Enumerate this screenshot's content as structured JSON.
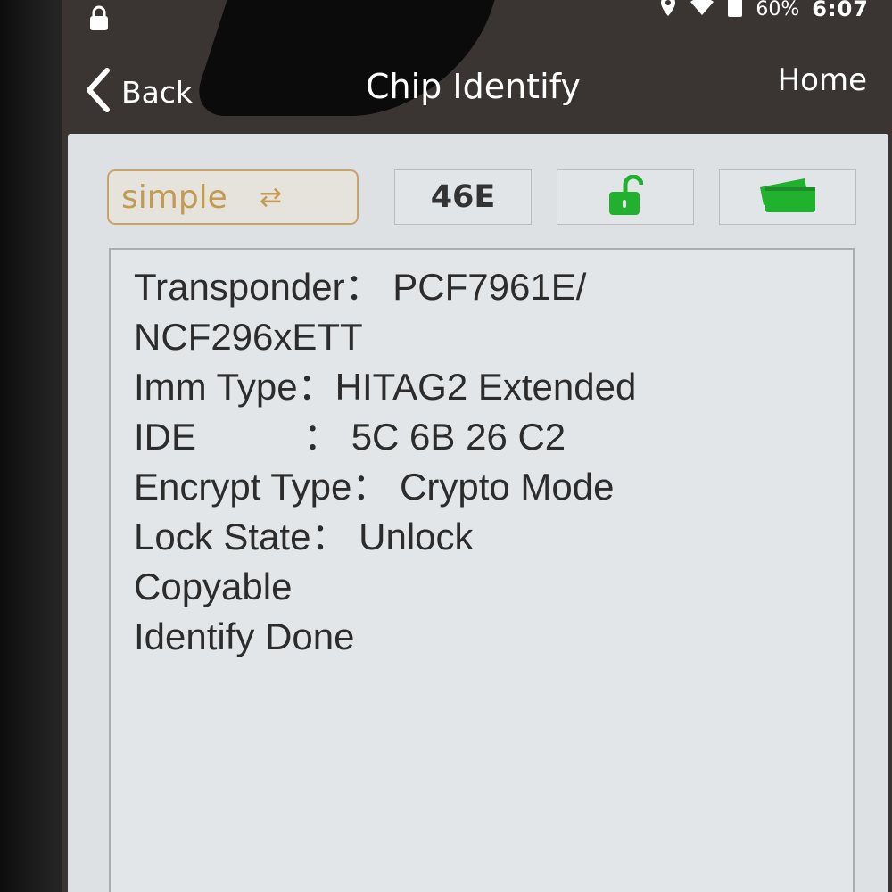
{
  "status_bar": {
    "battery": "60%",
    "time": "6:07",
    "icons": [
      "lock-icon",
      "location-icon",
      "wifi-icon",
      "battery-icon"
    ]
  },
  "header": {
    "back_label": "Back",
    "title": "Chip Identify",
    "home_label": "Home"
  },
  "toolbar": {
    "mode_label": "simple",
    "mode_icon": "swap-arrows-icon",
    "chip_label": "46E",
    "lock_icon": "unlocked-padlock-icon",
    "card_icon": "cards-icon",
    "accent_color": "#c29a52",
    "icon_color": "#22b02f"
  },
  "result": {
    "transponder_key": "Transponder：",
    "transponder_value": "PCF7961E/",
    "transponder_value_cont": "NCF296xETT",
    "imm_type_key": "Imm Type：",
    "imm_type_value": "HITAG2 Extended",
    "ide_key": "IDE",
    "ide_sep": "：",
    "ide_value": "5C 6B 26 C2",
    "encrypt_key": "Encrypt Type：",
    "encrypt_value": "Crypto Mode",
    "lock_key": "Lock State：",
    "lock_value": "Unlock",
    "copyable": "Copyable",
    "done": "Identify Done"
  }
}
